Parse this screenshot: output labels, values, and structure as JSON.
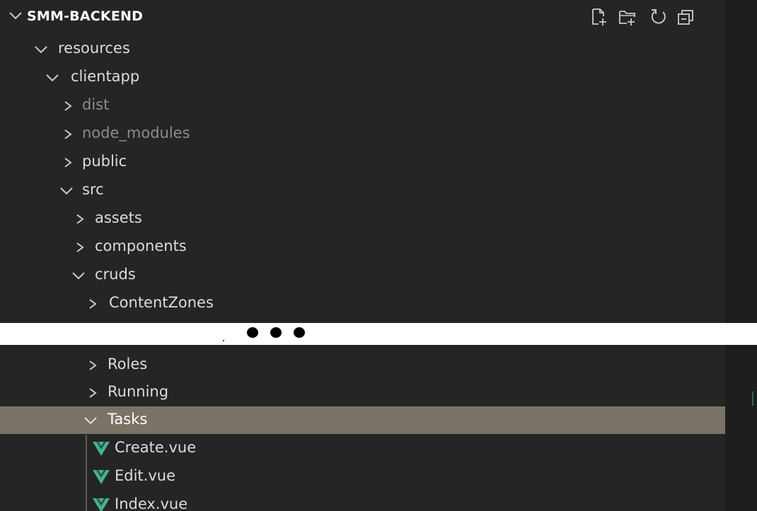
{
  "explorer": {
    "title": "SMM-BACKEND",
    "actions": [
      {
        "name": "new-file-icon"
      },
      {
        "name": "new-folder-icon"
      },
      {
        "name": "refresh-icon"
      },
      {
        "name": "collapse-all-icon"
      }
    ]
  },
  "tree_top": [
    {
      "label": "resources",
      "expanded": true
    },
    {
      "label": "clientapp",
      "expanded": true
    },
    {
      "label": "dist",
      "expanded": false,
      "dim": true
    },
    {
      "label": "node_modules",
      "expanded": false,
      "dim": true
    },
    {
      "label": "public",
      "expanded": false
    },
    {
      "label": "src",
      "expanded": true
    },
    {
      "label": "assets",
      "expanded": false
    },
    {
      "label": "components",
      "expanded": false
    },
    {
      "label": "cruds",
      "expanded": true
    },
    {
      "label": "ContentZones",
      "expanded": false
    }
  ],
  "ellipsis": "•••",
  "tree_bottom": [
    {
      "label": "Roles",
      "expanded": false
    },
    {
      "label": "Running",
      "expanded": false
    },
    {
      "label": "Tasks",
      "expanded": true,
      "selected": true
    },
    {
      "label": "Create.vue",
      "file": true
    },
    {
      "label": "Edit.vue",
      "file": true
    },
    {
      "label": "Index.vue",
      "file": true
    }
  ],
  "colors": {
    "background": "#252526",
    "selection": "#7a7264",
    "vue_green": "#41b883",
    "text": "#dcdcdc",
    "dim_text": "#8c8c8c"
  }
}
